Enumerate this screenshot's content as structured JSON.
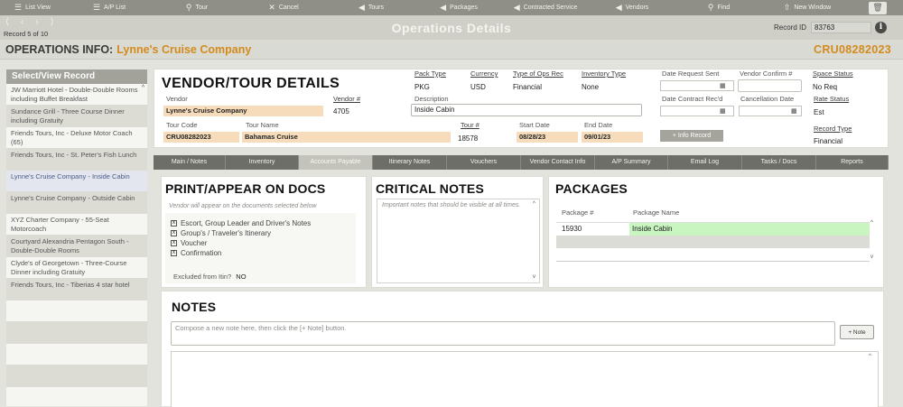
{
  "toolbar": {
    "items": [
      {
        "icon": "list-icon",
        "glyph": "☰",
        "label": "List View"
      },
      {
        "icon": "list-icon",
        "glyph": "☰",
        "label": "A/P List"
      },
      {
        "icon": "search-icon",
        "glyph": "⚲",
        "label": "Tour"
      },
      {
        "icon": "close-icon",
        "glyph": "✕",
        "label": "Cancel"
      },
      {
        "icon": "arrow-left-icon",
        "glyph": "◀",
        "label": "Tours"
      },
      {
        "icon": "arrow-left-icon",
        "glyph": "◀",
        "label": "Packages"
      },
      {
        "icon": "arrow-left-icon",
        "glyph": "◀",
        "label": "Contracted Service"
      },
      {
        "icon": "arrow-left-icon",
        "glyph": "◀",
        "label": "Vendors"
      },
      {
        "icon": "search-icon",
        "glyph": "⚲",
        "label": "Find"
      },
      {
        "icon": "new-window-icon",
        "glyph": "⇧",
        "label": "New Window"
      }
    ]
  },
  "header": {
    "record_of": "Record 5 of 10",
    "title": "Operations Details",
    "record_id_label": "Record ID",
    "record_id_value": "83763"
  },
  "ops": {
    "label": "OPERATIONS INFO:",
    "company": "Lynne's Cruise Company",
    "code": "CRU08282023"
  },
  "sidebar": {
    "title": "Select/View Record",
    "items": [
      {
        "label": "JW Marriott Hotel - Double-Double Rooms including Buffet Breakfast",
        "style": "plain"
      },
      {
        "label": "Sundance Grill - Three Course Dinner including Gratuity",
        "style": "alt"
      },
      {
        "label": "Friends Tours, Inc - Deluxe Motor Coach (65)",
        "style": "plain"
      },
      {
        "label": "Friends Tours, Inc - St. Peter's Fish Lunch",
        "style": "alt"
      },
      {
        "label": "Lynne's Cruise Company - Inside Cabin",
        "style": "sel"
      },
      {
        "label": "Lynne's Cruise Company - Outside Cabin",
        "style": "alt"
      },
      {
        "label": "XYZ Charter Company - 55-Seat Motorcoach",
        "style": "plain"
      },
      {
        "label": "Courtyard Alexandria Pentagon South - Double-Double Rooms",
        "style": "alt"
      },
      {
        "label": "Clyde's of Georgetown - Three-Course Dinner including Gratuity",
        "style": "plain"
      },
      {
        "label": "Friends Tours, Inc - Tiberias 4 star hotel",
        "style": "alt"
      }
    ]
  },
  "vendor": {
    "title": "VENDOR/TOUR DETAILS",
    "vendor_label": "Vendor",
    "vendor_value": "Lynne's Cruise Company",
    "vendor_no_label": "Vendor #",
    "vendor_no_value": "4705",
    "tour_code_label": "Tour Code",
    "tour_code_value": "CRU08282023",
    "tour_name_label": "Tour Name",
    "tour_name_value": "Bahamas Cruise",
    "tour_no_label": "Tour #",
    "tour_no_value": "18578",
    "pack_type_label": "Pack Type",
    "pack_type_value": "PKG",
    "currency_label": "Currency",
    "currency_value": "USD",
    "ops_rec_label": "Type of Ops Rec",
    "ops_rec_value": "Financial",
    "inventory_type_label": "Inventory Type",
    "inventory_type_value": "None",
    "description_label": "Description",
    "description_value": "Inside Cabin",
    "start_date_label": "Start Date",
    "start_date_value": "08/28/23",
    "end_date_label": "End Date",
    "end_date_value": "09/01/23",
    "date_request_label": "Date Request Sent",
    "vendor_confirm_label": "Vendor Confirm #",
    "space_status_label": "Space Status",
    "space_status_value": "No Req",
    "date_contract_label": "Date Contract Rec'd",
    "cancellation_label": "Cancellation Date",
    "rate_status_label": "Rate Status",
    "rate_status_value": "Est",
    "record_type_label": "Record Type",
    "record_type_value": "Financial",
    "info_record_button": "+ Info Record"
  },
  "tabs": [
    {
      "label": "Main / Notes",
      "active": false
    },
    {
      "label": "Inventory",
      "active": false
    },
    {
      "label": "Accounts Payable",
      "active": true
    },
    {
      "label": "Itinerary Notes",
      "active": false
    },
    {
      "label": "Vouchers",
      "active": false
    },
    {
      "label": "Vendor Contact Info",
      "active": false
    },
    {
      "label": "A/P Summary",
      "active": false
    },
    {
      "label": "Email Log",
      "active": false
    },
    {
      "label": "Tasks / Docs",
      "active": false
    },
    {
      "label": "Reports",
      "active": false
    }
  ],
  "print_panel": {
    "title": "PRINT/APPEAR ON DOCS",
    "note": "Vendor will appear on the documents selected below",
    "options": [
      {
        "label": "Escort, Group Leader and Driver's Notes",
        "checked": true
      },
      {
        "label": "Group's / Traveler's Itinerary",
        "checked": true
      },
      {
        "label": "Voucher",
        "checked": true
      },
      {
        "label": "Confirmation",
        "checked": true
      }
    ],
    "excluded_label": "Excluded from Itin?",
    "excluded_value": "NO"
  },
  "critical_panel": {
    "title": "CRITICAL NOTES",
    "placeholder": "Important notes that should be visible at all times."
  },
  "packages_panel": {
    "title": "PACKAGES",
    "col_no": "Package #",
    "col_name": "Package Name",
    "rows": [
      {
        "no": "15930",
        "name": "Inside Cabin"
      }
    ]
  },
  "notes_panel": {
    "title": "NOTES",
    "placeholder": "Compose a new note here, then click the [+ Note] button.",
    "add_button": "+ Note"
  }
}
